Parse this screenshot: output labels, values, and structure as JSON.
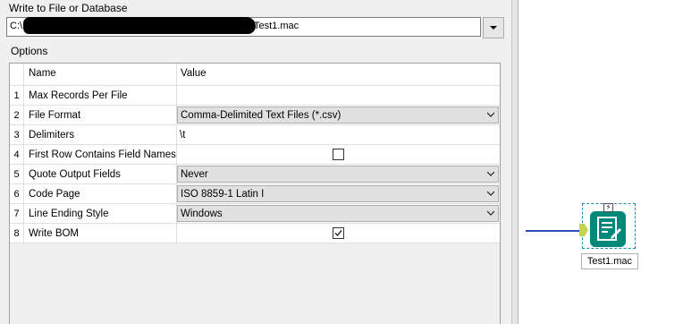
{
  "panel": {
    "write_label": "Write to File or Database",
    "path_prefix": "C:\\",
    "path_suffix": "Test1.mac",
    "options_label": "Options"
  },
  "grid": {
    "header_name": "Name",
    "header_value": "Value",
    "rows": [
      {
        "num": "1",
        "name": "Max Records Per File",
        "value": ""
      },
      {
        "num": "2",
        "name": "File Format",
        "value": "Comma-Delimited Text Files (*.csv)"
      },
      {
        "num": "3",
        "name": "Delimiters",
        "value": "\\t"
      },
      {
        "num": "4",
        "name": "First Row Contains Field Names",
        "value": ""
      },
      {
        "num": "5",
        "name": "Quote Output Fields",
        "value": "Never"
      },
      {
        "num": "6",
        "name": "Code Page",
        "value": "ISO 8859-1 Latin I"
      },
      {
        "num": "7",
        "name": "Line Ending Style",
        "value": "Windows"
      },
      {
        "num": "8",
        "name": "Write BOM",
        "value": ""
      }
    ]
  },
  "checkboxes": {
    "first_row_field_names": false,
    "write_bom": true
  },
  "canvas": {
    "node_label": "Test1.mac",
    "node_icon": "output-data-icon",
    "connection_color": "#2b4bbd",
    "tool_color": "#00887a",
    "anchor_color": "#c3d54f"
  }
}
